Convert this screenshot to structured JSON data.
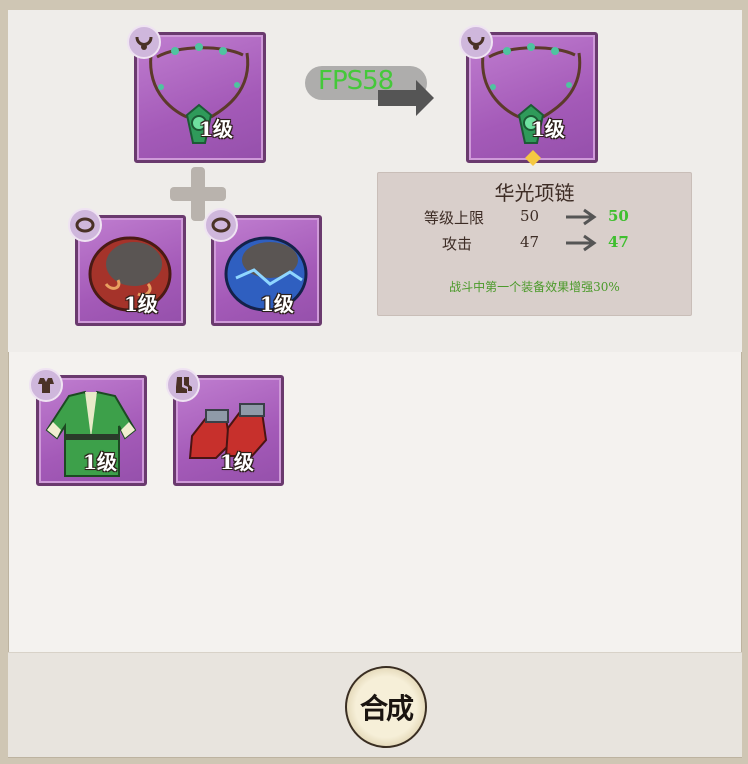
{
  "fusion": {
    "source_slot": {
      "item_icon": "jade-necklace-icon",
      "badge_icon": "necklace-slot-icon",
      "level": "1级"
    },
    "result_slot": {
      "item_icon": "jade-necklace-icon",
      "badge_icon": "necklace-slot-icon",
      "level": "1级"
    },
    "material_slots": [
      {
        "item_icon": "red-bracelet-icon",
        "badge_icon": "bracelet-slot-icon",
        "level": "1级"
      },
      {
        "item_icon": "blue-bracelet-icon",
        "badge_icon": "bracelet-slot-icon",
        "level": "1级"
      }
    ],
    "fps_overlay": "FPS58"
  },
  "result_info": {
    "name": "华光项链",
    "stats": [
      {
        "label": "等级上限",
        "old": "50",
        "new": "50"
      },
      {
        "label": "攻击",
        "old": "47",
        "new": "47"
      }
    ],
    "effect": "战斗中第一个装备效果增强30%"
  },
  "inventory": [
    {
      "item_icon": "green-robe-icon",
      "badge_icon": "armor-slot-icon",
      "level": "1级"
    },
    {
      "item_icon": "red-boots-icon",
      "badge_icon": "boots-slot-icon",
      "level": "1级"
    }
  ],
  "actions": {
    "compose_label": "合成"
  },
  "colors": {
    "slot_purple": "#a45ab8",
    "stat_increase_green": "#3fbf2f",
    "effect_green": "#4b9a2a"
  }
}
